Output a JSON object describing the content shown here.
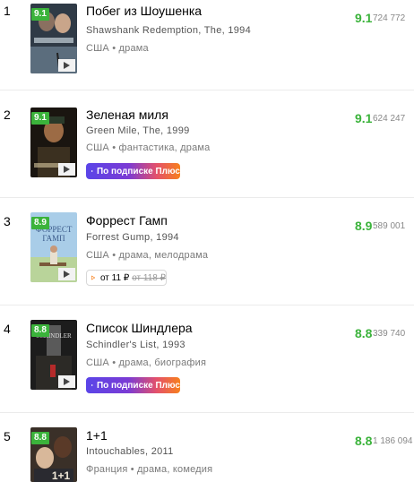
{
  "colors": {
    "rating_green": "#3bb33b",
    "plus_gradient": [
      "#5a45e8",
      "#7b3bd4",
      "#e4516b",
      "#f7801c"
    ],
    "buy_play_icon": "#f7801c"
  },
  "icons": {
    "trailer": "play-triangle-icon",
    "plus_button": "play-triangle-icon",
    "buy_button": "play-triangle-outline-icon"
  },
  "movies": [
    {
      "rank": "1",
      "badge": "9.1",
      "title": "Побег из Шоушенка",
      "original": "Shawshank Redemption, The, 1994",
      "meta": "США • драма",
      "rating": "9.1",
      "votes": "724 772"
    },
    {
      "rank": "2",
      "badge": "9.1",
      "title": "Зеленая миля",
      "original": "Green Mile, The, 1999",
      "meta": "США • фантастика, драма",
      "rating": "9.1",
      "votes": "624 247",
      "plus_label": "По подписке Плюс"
    },
    {
      "rank": "3",
      "badge": "8.9",
      "title": "Форрест Гамп",
      "original": "Forrest Gump, 1994",
      "meta": "США • драма, мелодрама",
      "rating": "8.9",
      "votes": "589 001",
      "buy_price": "от 11 ₽",
      "buy_old_price": "от 118 ₽"
    },
    {
      "rank": "4",
      "badge": "8.8",
      "title": "Список Шиндлера",
      "original": "Schindler's List, 1993",
      "meta": "США • драма, биография",
      "rating": "8.8",
      "votes": "339 740",
      "plus_label": "По подписке Плюс"
    },
    {
      "rank": "5",
      "badge": "8.8",
      "title": "1+1",
      "original": "Intouchables, 2011",
      "meta": "Франция • драма, комедия",
      "rating": "8.8",
      "votes": "1 186 094"
    }
  ]
}
